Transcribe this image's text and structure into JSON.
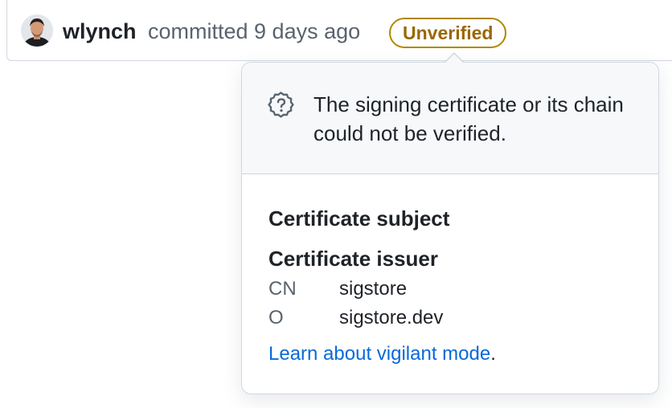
{
  "commit": {
    "author": "wlynch",
    "action_text": "committed 9 days ago",
    "badge_label": "Unverified"
  },
  "popover": {
    "header_message": "The signing certificate or its chain could not be verified.",
    "subject_title": "Certificate subject",
    "issuer_title": "Certificate issuer",
    "issuer_fields": [
      {
        "key": "CN",
        "value": "sigstore"
      },
      {
        "key": "O",
        "value": "sigstore.dev"
      }
    ],
    "learn_link_text": "Learn about vigilant mode",
    "learn_suffix": "."
  },
  "icons": {
    "avatar": "user-avatar",
    "header_icon": "question-icon"
  },
  "colors": {
    "badge_border": "#b08800",
    "badge_text": "#9a6700",
    "link": "#0969da",
    "header_bg": "#f6f8fa"
  }
}
